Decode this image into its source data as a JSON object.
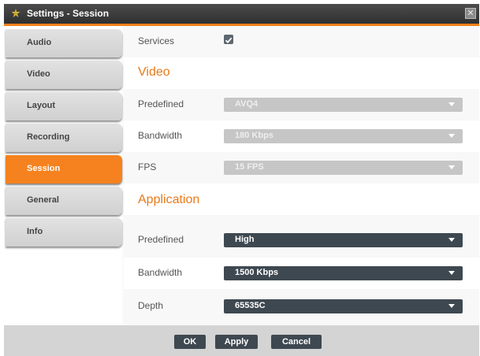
{
  "window": {
    "title": "Settings - Session",
    "close_glyph": "✕"
  },
  "sidebar": {
    "items": [
      {
        "label": "Audio"
      },
      {
        "label": "Video"
      },
      {
        "label": "Layout"
      },
      {
        "label": "Recording"
      },
      {
        "label": "Session",
        "active": true
      },
      {
        "label": "General"
      },
      {
        "label": "Info"
      }
    ]
  },
  "services": {
    "label": "Services",
    "checked": true
  },
  "video": {
    "heading": "Video",
    "predefined": {
      "label": "Predefined",
      "value": "AVQ4"
    },
    "bandwidth": {
      "label": "Bandwidth",
      "value": "180 Kbps"
    },
    "fps": {
      "label": "FPS",
      "value": "15 FPS"
    }
  },
  "application": {
    "heading": "Application",
    "predefined": {
      "label": "Predefined",
      "value": "High"
    },
    "bandwidth": {
      "label": "Bandwidth",
      "value": "1500 Kbps"
    },
    "depth": {
      "label": "Depth",
      "value": "65535C"
    }
  },
  "footer": {
    "ok": "OK",
    "apply": "Apply",
    "cancel": "Cancel"
  },
  "colors": {
    "accent": "#F5821F",
    "dark": "#3E4850",
    "disabled": "#C6C6C6",
    "titlebar": "#3A3A3A"
  },
  "icons": {
    "title": "settings-icon",
    "close": "close-icon",
    "check": "checkmark-icon",
    "dropdown": "chevron-down-icon"
  }
}
